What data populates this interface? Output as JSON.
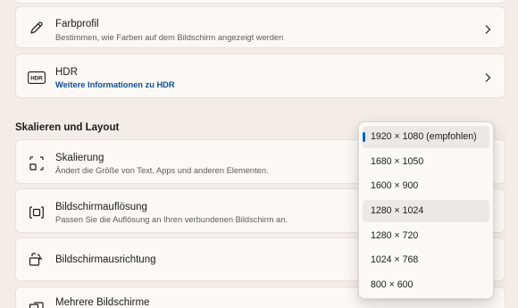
{
  "display_cards": [
    {
      "title": "Farbprofil",
      "subtitle": "Bestimmen, wie Farben auf dem Bildschirm angezeigt werden",
      "icon": "pen-icon"
    },
    {
      "title": "HDR",
      "subtitle": "Weitere Informationen zu HDR",
      "icon": "hdr-icon"
    }
  ],
  "section": {
    "title": "Skalieren und Layout"
  },
  "layout_cards": [
    {
      "title": "Skalierung",
      "subtitle": "Ändert die Größe von Text, Apps und anderen Elementen.",
      "icon": "scale-icon"
    },
    {
      "title": "Bildschirmauflösung",
      "subtitle": "Passen Sie die Auflösung an Ihren verbundenen Bildschirm an.",
      "icon": "resolution-icon"
    },
    {
      "title": "Bildschirmausrichtung",
      "icon": "orientation-icon"
    },
    {
      "title": "Mehrere Bildschirme",
      "icon": "multiple-displays-icon"
    }
  ],
  "hdr_icon_text": "HDR",
  "resolution_dropdown": {
    "options": [
      "1920 × 1080 (empfohlen)",
      "1680 × 1050",
      "1600 × 900",
      "1280 × 1024",
      "1280 × 720",
      "1024 × 768",
      "800 × 600"
    ],
    "selected": "1920 × 1080 (empfohlen)",
    "hovered": "1280 × 1024"
  },
  "colors": {
    "accent": "#0067c0",
    "link": "#0b4f9c",
    "background": "#f3ece8",
    "card": "#fbf8f6"
  }
}
